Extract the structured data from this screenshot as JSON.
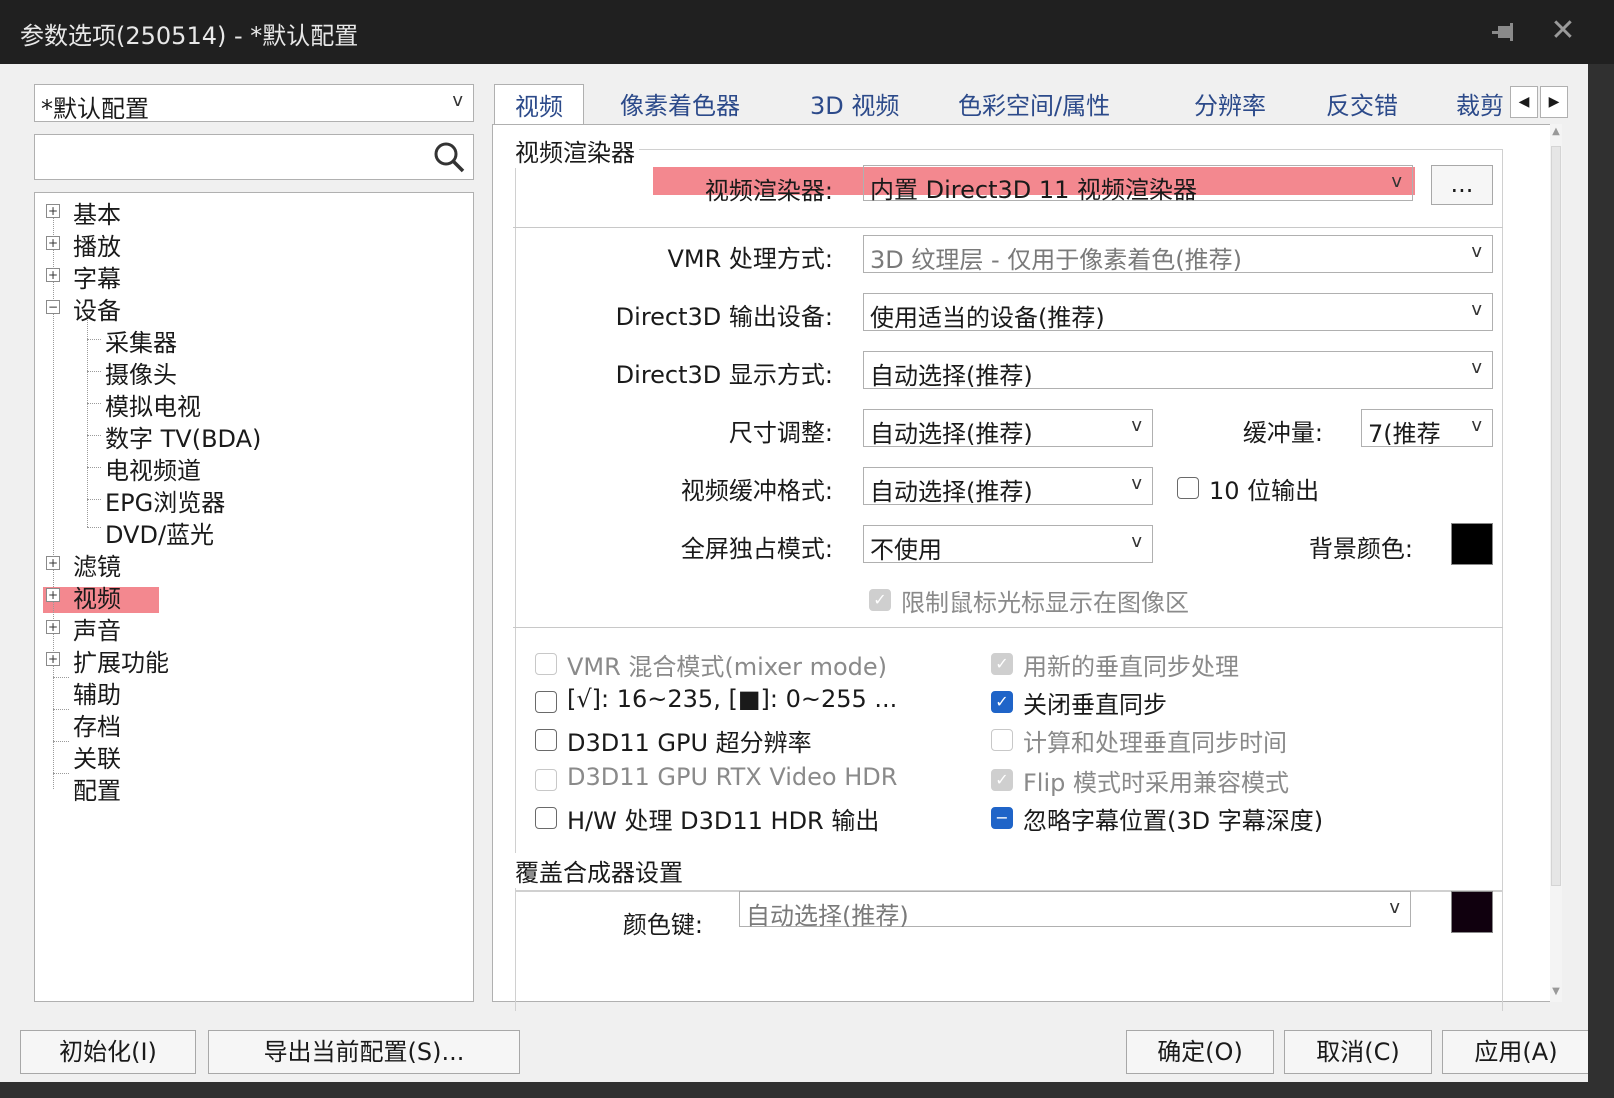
{
  "window": {
    "title": "参数选项(250514) - *默认配置",
    "pin_icon": "pin-icon",
    "close_icon": "close-icon"
  },
  "profile": {
    "selected": "*默认配置"
  },
  "search": {
    "value": ""
  },
  "tree": {
    "items": [
      {
        "label": "基本"
      },
      {
        "label": "播放"
      },
      {
        "label": "字幕"
      },
      {
        "label": "设备"
      },
      {
        "label": "采集器"
      },
      {
        "label": "摄像头"
      },
      {
        "label": "模拟电视"
      },
      {
        "label": "数字 TV(BDA)"
      },
      {
        "label": "电视频道"
      },
      {
        "label": "EPG浏览器"
      },
      {
        "label": "DVD/蓝光"
      },
      {
        "label": "滤镜"
      },
      {
        "label": "视频"
      },
      {
        "label": "声音"
      },
      {
        "label": "扩展功能"
      },
      {
        "label": "辅助"
      },
      {
        "label": "存档"
      },
      {
        "label": "关联"
      },
      {
        "label": "配置"
      }
    ],
    "selected": "视频"
  },
  "tabs": [
    {
      "label": "视频"
    },
    {
      "label": "像素着色器"
    },
    {
      "label": "3D 视频"
    },
    {
      "label": "色彩空间/属性"
    },
    {
      "label": "分辨率"
    },
    {
      "label": "反交错"
    },
    {
      "label": "裁剪"
    }
  ],
  "renderer_group": {
    "title": "视频渲染器",
    "renderer_label": "视频渲染器:",
    "renderer_value": "内置 Direct3D 11 视频渲染器",
    "more_button": "...",
    "vmr_label": "VMR 处理方式:",
    "vmr_value": "3D 纹理层 - 仅用于像素着色(推荐)",
    "d3d_device_label": "Direct3D 输出设备:",
    "d3d_device_value": "使用适当的设备(推荐)",
    "d3d_display_label": "Direct3D 显示方式:",
    "d3d_display_value": "自动选择(推荐)",
    "resize_label": "尺寸调整:",
    "resize_value": "自动选择(推荐)",
    "buffer_label": "缓冲量:",
    "buffer_value": "7(推荐",
    "buffer_format_label": "视频缓冲格式:",
    "buffer_format_value": "自动选择(推荐)",
    "ten_bit_label": "10 位输出",
    "fullscreen_label": "全屏独占模式:",
    "fullscreen_value": "不使用",
    "bgcolor_label": "背景颜色:",
    "bgcolor": "#000000",
    "limit_cursor_label": "限制鼠标光标显示在图像区"
  },
  "options": {
    "left": [
      {
        "label": "VMR 混合模式(mixer mode)",
        "state": "disabled"
      },
      {
        "label": "[√]: 16~235, [■]: 0~255 ...",
        "state": "unchecked"
      },
      {
        "label": "D3D11 GPU 超分辨率",
        "state": "unchecked"
      },
      {
        "label": "D3D11 GPU RTX Video HDR",
        "state": "disabled"
      },
      {
        "label": "H/W 处理 D3D11 HDR 输出",
        "state": "unchecked"
      }
    ],
    "right": [
      {
        "label": "用新的垂直同步处理",
        "state": "disabled-checked"
      },
      {
        "label": "关闭垂直同步",
        "state": "checked"
      },
      {
        "label": "计算和处理垂直同步时间",
        "state": "disabled"
      },
      {
        "label": "Flip 模式时采用兼容模式",
        "state": "disabled-checked"
      },
      {
        "label": "忽略字幕位置(3D 字幕深度)",
        "state": "indeterminate"
      }
    ]
  },
  "overlay_group": {
    "title": "覆盖合成器设置",
    "colorkey_label": "颜色键:",
    "colorkey_value": "自动选择(推荐)",
    "colorkey_swatch": "#10000e"
  },
  "footer": {
    "reset": "初始化(I)",
    "export": "导出当前配置(S)...",
    "ok": "确定(O)",
    "cancel": "取消(C)",
    "apply": "应用(A)"
  },
  "colors": {
    "accent": "#1f64c8",
    "highlight": "#f3888f",
    "tab_text": "#2c4a8a"
  }
}
